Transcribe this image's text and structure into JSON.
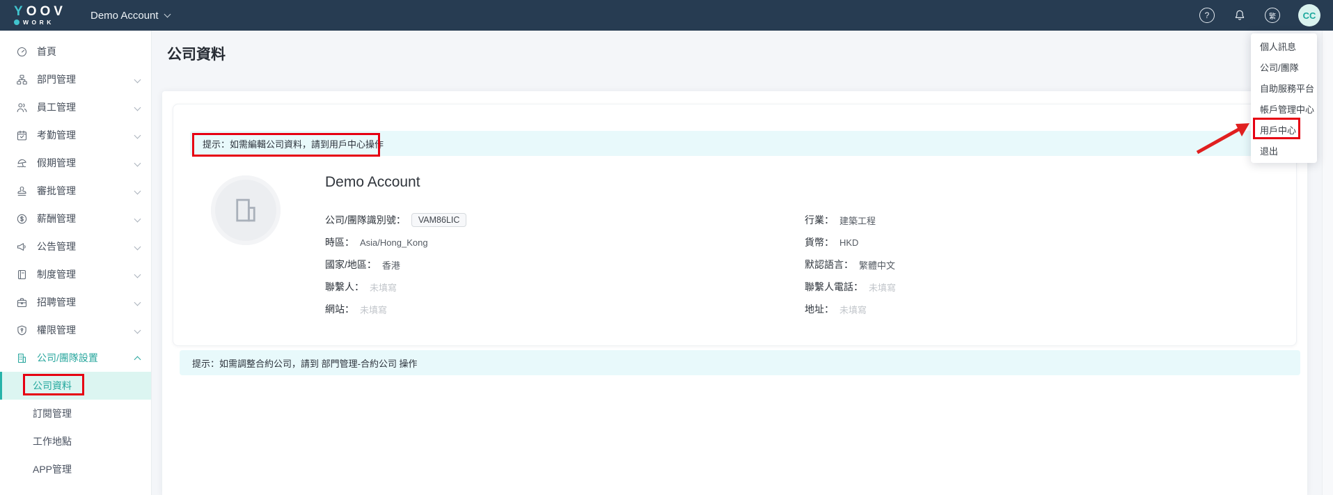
{
  "topbar": {
    "logo": {
      "accent": "Y",
      "rest": "OOV",
      "sub": "WORK"
    },
    "account_switcher_label": "Demo Account",
    "help_glyph": "?",
    "language_badge": "繁",
    "avatar_initials": "CC"
  },
  "sidebar": {
    "items": [
      {
        "label": "首頁"
      },
      {
        "label": "部門管理"
      },
      {
        "label": "員工管理"
      },
      {
        "label": "考勤管理"
      },
      {
        "label": "假期管理"
      },
      {
        "label": "審批管理"
      },
      {
        "label": "薪酬管理"
      },
      {
        "label": "公告管理"
      },
      {
        "label": "制度管理"
      },
      {
        "label": "招聘管理"
      },
      {
        "label": "權限管理"
      },
      {
        "label": "公司/團隊設置"
      }
    ],
    "subitems": [
      {
        "label": "公司資料"
      },
      {
        "label": "訂閱管理"
      },
      {
        "label": "工作地點"
      },
      {
        "label": "APP管理"
      }
    ]
  },
  "page": {
    "title": "公司資料"
  },
  "company_card": {
    "tip": "提示：如需編輯公司資料，請到用戶中心操作",
    "name": "Demo Account",
    "fields_left": [
      {
        "label": "公司/團隊識別號：",
        "value": "VAM86LIC"
      },
      {
        "label": "時區：",
        "value": "Asia/Hong_Kong"
      },
      {
        "label": "國家/地區：",
        "value": "香港"
      },
      {
        "label": "聯繫人：",
        "value": "未填寫"
      },
      {
        "label": "網站：",
        "value": "未填寫"
      }
    ],
    "fields_right": [
      {
        "label": "行業：",
        "value": "建築工程"
      },
      {
        "label": "貨幣：",
        "value": "HKD"
      },
      {
        "label": "默認語言：",
        "value": "繁體中文"
      },
      {
        "label": "聯繫人電話：",
        "value": "未填寫"
      },
      {
        "label": "地址：",
        "value": "未填寫"
      }
    ]
  },
  "bottom_tip": "提示：如需調整合約公司，請到 部門管理-合約公司 操作",
  "user_menu": {
    "items": [
      "個人訊息",
      "公司/團隊",
      "自助服務平台",
      "帳戶管理中心",
      "用戶中心",
      "退出"
    ]
  },
  "colors": {
    "accent_teal": "#27a69d",
    "topbar_bg": "#273c52",
    "tip_bg": "#e8f9fb",
    "annotation_red": "#e60012",
    "selected_item_bg": "#dcf5f1"
  }
}
